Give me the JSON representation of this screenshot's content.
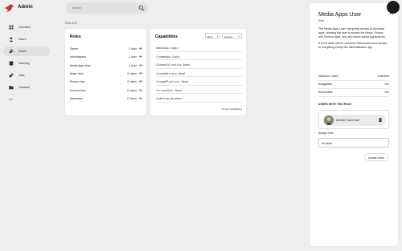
{
  "header": {
    "app_name": "Admin",
    "search_placeholder": "Search"
  },
  "sidebar": {
    "items": [
      {
        "label": "Overview",
        "icon": "grid-icon",
        "active": false
      },
      {
        "label": "Users",
        "icon": "person-icon",
        "active": false
      },
      {
        "label": "Roles",
        "icon": "wrench-icon",
        "active": true
      },
      {
        "label": "Indexing",
        "icon": "db-icon",
        "active": false
      },
      {
        "label": "Jobs",
        "icon": "jobs-icon",
        "active": false
      },
      {
        "label": "Libraries",
        "icon": "folder-icon",
        "active": false
      }
    ]
  },
  "main": {
    "page_title": "ROLES",
    "roles_card": {
      "title": "Roles",
      "roles": [
        {
          "name": "Owner",
          "count": "1 User"
        },
        {
          "name": "Administrator",
          "count": "1 User"
        },
        {
          "name": "Media Apps User",
          "count": "1 User"
        },
        {
          "name": "Music User",
          "count": "0 Users"
        },
        {
          "name": "Photos User",
          "count": "0 Users"
        },
        {
          "name": "Cinema User",
          "count": "0 Users"
        },
        {
          "name": "Newcomer",
          "count": "0 Users"
        }
      ]
    },
    "caps_card": {
      "title": "Capabilities",
      "sort_by": "Role",
      "sort_order": "Ascend",
      "capabilities": [
        "AdminApp.Login",
        "CinemaApp.Login",
        "CinemaCollection.Read",
        "CinemaHistory.Read",
        "CinemaPlaylists.Read",
        "CurrentUser.Read",
        "Indexing.Decodes"
      ],
      "total": "42 total capabilities"
    }
  },
  "panel": {
    "title": "Media Apps User",
    "subtitle": "Role",
    "description_1": "The Media Apps User role grants access to all media apps, allowing the user to access the Music, Photos, and Cinema apps, and also future media applications.",
    "description_2": "It is the ideal role for someone that should have access to everything except the Administration app.",
    "max_users_label": "Maximum Users",
    "max_users_value": "Unlimited",
    "assignable_label": "Assignable",
    "assignable_value": "Yes",
    "removable_label": "Removable",
    "removable_value": "Yes",
    "users_section": "USERS WITH THIS ROLE",
    "user_name": "Another Cloud User",
    "assign_label": "Assign Role",
    "assign_value": "No items",
    "update_button": "Update Users"
  },
  "colors": {
    "accent": "#c0392b",
    "background": "#eeeeee",
    "card": "#ffffff"
  }
}
